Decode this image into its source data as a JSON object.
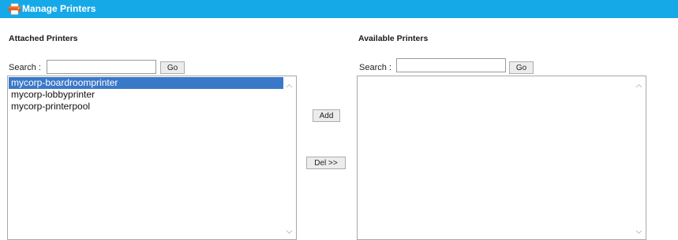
{
  "window": {
    "title": "Manage Printers"
  },
  "attached": {
    "heading": "Attached Printers",
    "search_label": "Search :",
    "search_value": "",
    "go_label": "Go",
    "items": [
      {
        "label": "mycorp-boardroomprinter",
        "selected": true
      },
      {
        "label": "mycorp-lobbyprinter",
        "selected": false
      },
      {
        "label": "mycorp-printerpool",
        "selected": false
      }
    ]
  },
  "actions": {
    "add_label": "Add",
    "del_label": "Del >>"
  },
  "available": {
    "heading": "Available Printers",
    "search_label": "Search :",
    "search_value": "",
    "go_label": "Go",
    "items": []
  },
  "colors": {
    "titlebar": "#16a9e8",
    "selection": "#3a78c8"
  },
  "icons": {
    "title": "printer-icon",
    "scroll_up": "scroll-up-arrow-icon",
    "scroll_down": "scroll-down-arrow-icon"
  }
}
